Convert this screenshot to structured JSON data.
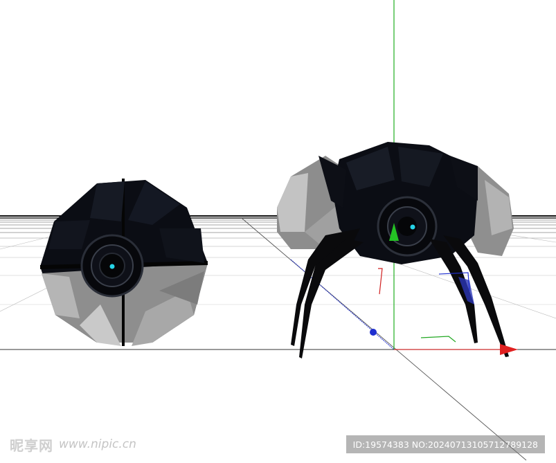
{
  "viewport": {
    "background": "#ffffff",
    "axis_colors": {
      "y": "#1fae1f",
      "x": "#e02020",
      "z": "#1f2fd0",
      "pivot": "#26d4e8"
    }
  },
  "models": [
    {
      "name": "ball-closed",
      "shell_color": "#0b0d14",
      "plate_color": "#9a9a9a"
    },
    {
      "name": "spider-open",
      "shell_color": "#0b0d14",
      "plate_color": "#9a9a9a"
    }
  ],
  "watermark": {
    "brand": "昵享网",
    "url": "www.nipic.cn",
    "id_text": "ID:19574383 NO:20240713105712789128"
  }
}
